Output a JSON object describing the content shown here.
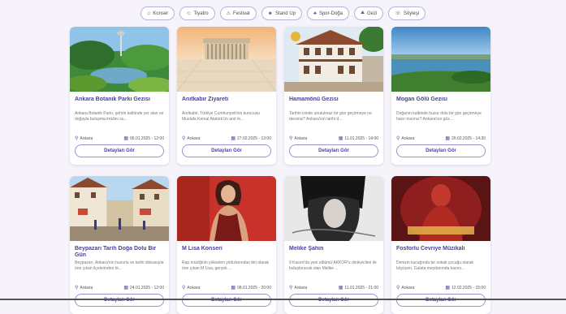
{
  "filters": [
    {
      "label": "Konser",
      "icon": "music-icon",
      "glyph": "♫"
    },
    {
      "label": "Tiyatro",
      "icon": "theater-icon",
      "glyph": "☺"
    },
    {
      "label": "Festival",
      "icon": "festival-icon",
      "glyph": "⚠"
    },
    {
      "label": "Stand Up",
      "icon": "microphone-icon",
      "glyph": "☻"
    },
    {
      "label": "Spor-Doğa",
      "icon": "nature-icon",
      "glyph": "♣"
    },
    {
      "label": "Gezi",
      "icon": "travel-icon",
      "glyph": "⛰"
    },
    {
      "label": "Söyleşi",
      "icon": "chat-icon",
      "glyph": "☏"
    }
  ],
  "cards": [
    {
      "title": "Ankara Botanik Parkı Gezisi",
      "desc": "Ankara Botanik Parkı, şehrin kalbinde yer alan ve doğayla buluşma imkânı su...",
      "location": "Ankara",
      "date": "06.01.2025 - 12:00",
      "button": "Detayları Gör"
    },
    {
      "title": "Anıtkabir Ziyareti",
      "desc": "Anıtkabir, Türkiye Cumhuriyeti'nin kurucusu Mustafa Kemal Atatürk'ün anıt m...",
      "location": "Ankara",
      "date": "27.02.2025 - 13:00",
      "button": "Detayları Gör"
    },
    {
      "title": "Hamamönü Gezisi",
      "desc": "Tarihin izinde unutulmaz bir gün geçirmeye ne dersiniz? Ankara'nın tarihi d...",
      "location": "Ankara",
      "date": "11.01.2025 - 14:00",
      "button": "Detayları Gör"
    },
    {
      "title": "Mogan Gölü Gezisi",
      "desc": "Doğanın kalbinde huzur dolu bir gün geçirmeye hazır mısınız? Ankara'nın göz...",
      "location": "Ankara",
      "date": "20.02.2025 - 14:30",
      "button": "Detayları Gör"
    },
    {
      "title": "Beypazarı Tarih Doğa Dolu Bir Gün",
      "desc": "Beypazarı, Ankara'nın huzurlu ve tarihi dokusuyla öne çıkan ilçelerinden bi...",
      "location": "Ankara",
      "date": "24.01.2025 - 12:00",
      "button": "Detayları Gör"
    },
    {
      "title": "M Lisa Konseri",
      "desc": "Rap müziğinin yükselen yıldızlarından biri olarak öne çıkan M Lisa, gerçek ...",
      "location": "Ankara",
      "date": "08.01.2025 - 20:00",
      "button": "Detayları Gör"
    },
    {
      "title": "Melike Şahin",
      "desc": "9 Kasım'da yeni albümü AKKOR'u dinleyicileri ile buluşturacak olan Melike ...",
      "location": "Ankara",
      "date": "11.01.2025 - 21:00",
      "button": "Detayları Gör"
    },
    {
      "title": "Fosforlu Cevriye Müzikali",
      "desc": "Denizin kucağında bir sokak çocuğu olarak büyüyen, Galata meydanında kavını...",
      "location": "Ankara",
      "date": "12.02.2025 - 15:00",
      "button": "Detayları Gör"
    }
  ]
}
